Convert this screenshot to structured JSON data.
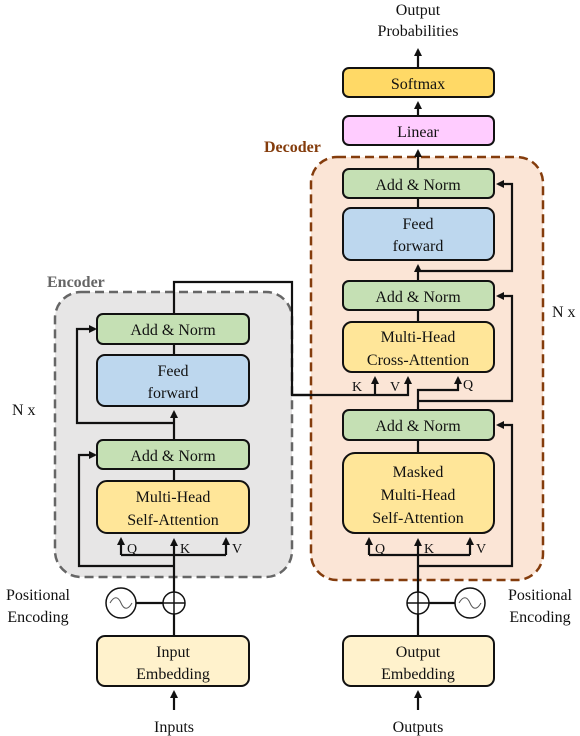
{
  "colors": {
    "add_norm": "#c5e0b4",
    "feed_forward": "#bdd7ee",
    "attention": "#ffe699",
    "embedding": "#fff2cc",
    "linear": "#ffccff",
    "softmax": "#ffd966",
    "encoder_bg": "#e7e6e6",
    "encoder_border": "#666666",
    "decoder_bg": "#fbe5d6",
    "decoder_border": "#843c0c"
  },
  "encoder": {
    "label": "Encoder",
    "repeat": "N x",
    "add_norm_top": "Add & Norm",
    "feed_forward": [
      "Feed",
      "forward"
    ],
    "add_norm_bottom": "Add & Norm",
    "attention": [
      "Multi-Head",
      "Self-Attention"
    ],
    "q": "Q",
    "k": "K",
    "v": "V",
    "positional": [
      "Positional",
      "Encoding"
    ],
    "embedding": [
      "Input",
      "Embedding"
    ],
    "input_label": "Inputs"
  },
  "decoder": {
    "label": "Decoder",
    "repeat": "N x",
    "add_norm_top": "Add & Norm",
    "feed_forward": [
      "Feed",
      "forward"
    ],
    "add_norm_mid": "Add & Norm",
    "cross_attention": [
      "Multi-Head",
      "Cross-Attention"
    ],
    "cross_k": "K",
    "cross_v": "V",
    "cross_q": "Q",
    "add_norm_bottom": "Add & Norm",
    "masked_attention": [
      "Masked",
      "Multi-Head",
      "Self-Attention"
    ],
    "q": "Q",
    "k": "K",
    "v": "V",
    "positional": [
      "Positional",
      "Encoding"
    ],
    "embedding": [
      "Output",
      "Embedding"
    ],
    "input_label": "Outputs"
  },
  "head": {
    "linear": "Linear",
    "softmax": "Softmax",
    "output_label": [
      "Output",
      "Probabilities"
    ]
  }
}
